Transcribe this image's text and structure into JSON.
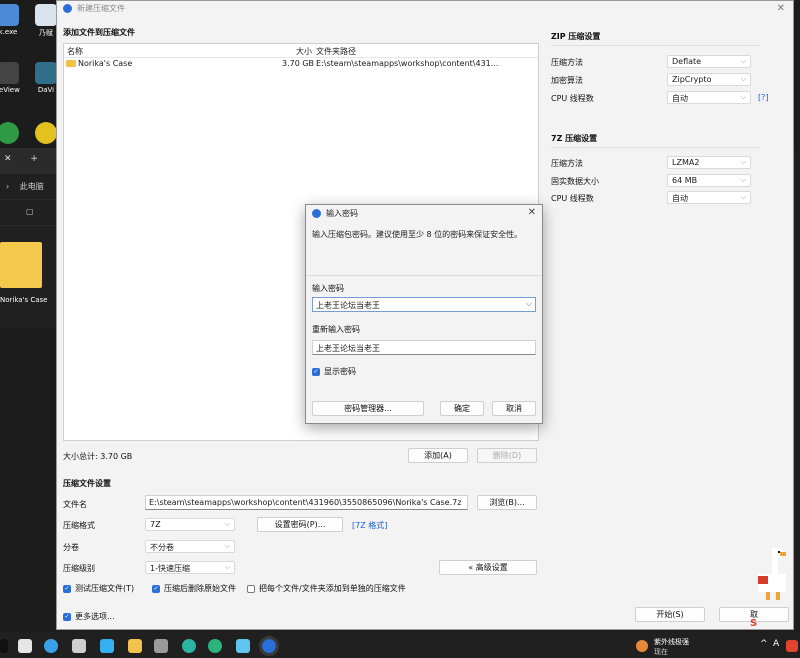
{
  "desktop": {
    "icons": [
      {
        "label": "k.exe",
        "color": "#4d8ad6"
      },
      {
        "label": "乃赋",
        "color": "#d8e3ee"
      },
      {
        "label": "reView",
        "color": "#444444"
      },
      {
        "label": "DaVi",
        "color": "#2f6f8a"
      },
      {
        "label": "",
        "color": "#2f9a45"
      },
      {
        "label": "",
        "color": "#e2c21e"
      }
    ],
    "explorer_tab_plus": "+",
    "explorer_breadcrumb": "此电脑",
    "folder_label": "Norika's Case"
  },
  "window": {
    "title": "新建压缩文件",
    "close_glyph": "✕",
    "add_files_title": "添加文件到压缩文件",
    "file_list": {
      "col_name": "名称",
      "col_size": "大小",
      "col_path": "文件夹路径",
      "rows": [
        {
          "name": "Norika's Case",
          "size": "3.70 GB",
          "path": "E:\\steam\\steamapps\\workshop\\content\\431..."
        }
      ]
    },
    "total_size": "大小总计: 3.70 GB",
    "add_button": "添加(A)",
    "remove_button": "删除(D)",
    "settings_title": "压缩文件设置",
    "filename_label": "文件名",
    "filename_value": "E:\\steam\\steamapps\\workshop\\content\\431960\\3550865096\\Norika's Case.7z",
    "browse_button": "浏览(B)...",
    "format_label": "压缩格式",
    "format_value": "7Z",
    "set_password_button": "设置密码(P)...",
    "format_link": "[7Z 格式]",
    "split_label": "分卷",
    "split_value": "不分卷",
    "level_label": "压缩级别",
    "level_value": "1-快速压缩",
    "advanced_button": "« 高级设置",
    "options": [
      {
        "label": "测试压缩文件(T)",
        "checked": true
      },
      {
        "label": "压缩后删除原始文件",
        "checked": true
      },
      {
        "label": "把每个文件/文件夹添加到单独的压缩文件",
        "checked": false
      }
    ],
    "more_options": {
      "label": "更多选项...",
      "checked": true
    },
    "start_button": "开始(S)",
    "cancel_button_partial": "取"
  },
  "zip_settings": {
    "title": "ZIP 压缩设置",
    "method_label": "压缩方法",
    "method_value": "Deflate",
    "encryption_label": "加密算法",
    "encryption_value": "ZipCrypto",
    "threads_label": "CPU 线程数",
    "threads_value": "自动",
    "help_link": "[?]"
  },
  "sevenz_settings": {
    "title": "7Z 压缩设置",
    "method_label": "压缩方法",
    "method_value": "LZMA2",
    "block_label": "固实数据大小",
    "block_value": "64 MB",
    "threads_label": "CPU 线程数",
    "threads_value": "自动"
  },
  "password_dialog": {
    "title": "输入密码",
    "close_glyph": "✕",
    "hint": "输入压缩包密码。建议使用至少 8 位的密码来保证安全性。",
    "password_label": "输入密码",
    "password_value": "上老王论坛当老王",
    "confirm_label": "重新输入密码",
    "confirm_value": "上老王论坛当老王",
    "show_password_label": "显示密码",
    "show_password_checked": true,
    "manager_button": "密码管理器...",
    "ok_button": "确定",
    "cancel_button": "取消"
  },
  "taskbar": {
    "icons": [
      {
        "name": "task-view-icon",
        "color": "#e6e6e6"
      },
      {
        "name": "browser-icon",
        "color": "#3aa0e8"
      },
      {
        "name": "keyboard-icon",
        "color": "#cfcfcf"
      },
      {
        "name": "qq-icon",
        "color": "#35b0f0"
      },
      {
        "name": "file-explorer-icon",
        "color": "#f2c14e"
      },
      {
        "name": "film-icon",
        "color": "#9a9a9a"
      },
      {
        "name": "edge-icon",
        "color": "#2bb3a3"
      },
      {
        "name": "bilibili-icon",
        "color": "#5ec4f0"
      },
      {
        "name": "compressor-icon",
        "color": "#2a6fd8"
      }
    ],
    "notification_title": "紫外线极强",
    "notification_sub": "现在",
    "ime_label": "A",
    "tray_icons": [
      "S",
      "^"
    ]
  }
}
